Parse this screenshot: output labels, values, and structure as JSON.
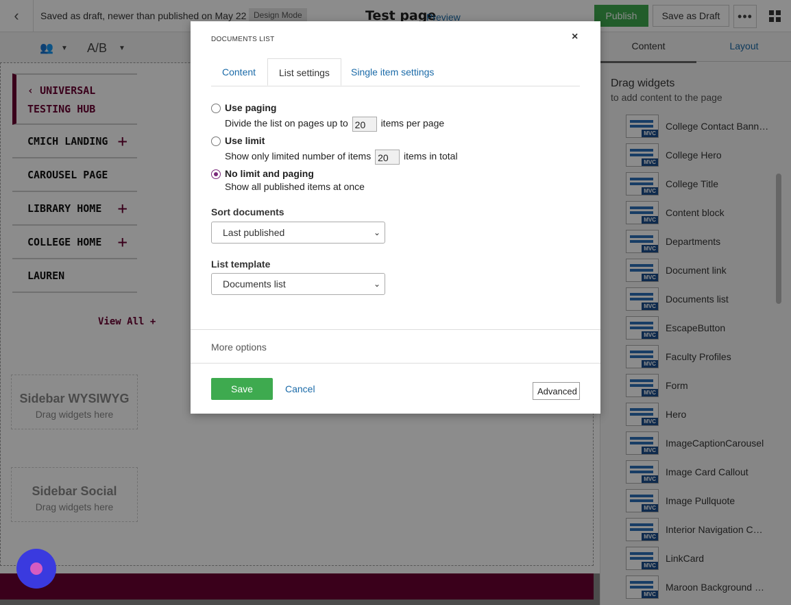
{
  "topbar": {
    "status": "Saved as draft, newer than published on May 22",
    "mode": "Design Mode",
    "page_title": "Test page",
    "preview": "Preview",
    "publish": "Publish",
    "save_draft": "Save as Draft",
    "more": "•••"
  },
  "toolbar": {
    "ab": "A/B"
  },
  "site_nav": {
    "head_line1": "UNIVERSAL",
    "head_line2": "TESTING HUB",
    "items": [
      {
        "label": "CMICH LANDING",
        "expandable": true
      },
      {
        "label": "CAROUSEL PAGE",
        "expandable": false
      },
      {
        "label": "LIBRARY HOME",
        "expandable": true
      },
      {
        "label": "COLLEGE HOME",
        "expandable": true
      },
      {
        "label": "LAUREN",
        "expandable": false
      }
    ],
    "view_all": "View All"
  },
  "drop_zones": [
    {
      "title": "Sidebar WYSIWYG",
      "hint": "Drag widgets here"
    },
    {
      "title": "Sidebar Social",
      "hint": "Drag widgets here"
    }
  ],
  "right_panel": {
    "tabs": [
      "Content",
      "Layout"
    ],
    "title": "Drag widgets",
    "subtitle": "to add content to the page",
    "widgets": [
      "College Contact Bann…",
      "College Hero",
      "College Title",
      "Content block",
      "Departments",
      "Document link",
      "Documents list",
      "EscapeButton",
      "Faculty Profiles",
      "Form",
      "Hero",
      "ImageCaptionCarousel",
      "Image Card Callout",
      "Image Pullquote",
      "Interior Navigation C…",
      "LinkCard",
      "Maroon Background …"
    ],
    "badge": "MVC"
  },
  "modal": {
    "title": "DOCUMENTS LIST",
    "close": "×",
    "tabs": [
      "Content",
      "List settings",
      "Single item settings"
    ],
    "active_tab": "List settings",
    "options": [
      {
        "label": "Use paging",
        "desc_before": "Divide the list on pages up to",
        "value": "20",
        "desc_after": "items per page",
        "checked": false
      },
      {
        "label": "Use limit",
        "desc_before": "Show only limited number of items",
        "value": "20",
        "desc_after": "items in total",
        "checked": false
      },
      {
        "label": "No limit and paging",
        "desc_before": "Show all published items at once",
        "checked": true
      }
    ],
    "sort_label": "Sort documents",
    "sort_value": "Last published",
    "template_label": "List template",
    "template_value": "Documents list",
    "more_options": "More options",
    "save": "Save",
    "cancel": "Cancel",
    "advanced": "Advanced"
  },
  "colors": {
    "accent_green": "#3eaa4f",
    "link_blue": "#1a6aa8",
    "maroon": "#6a0032",
    "radio_checked": "#7a2a7a"
  }
}
